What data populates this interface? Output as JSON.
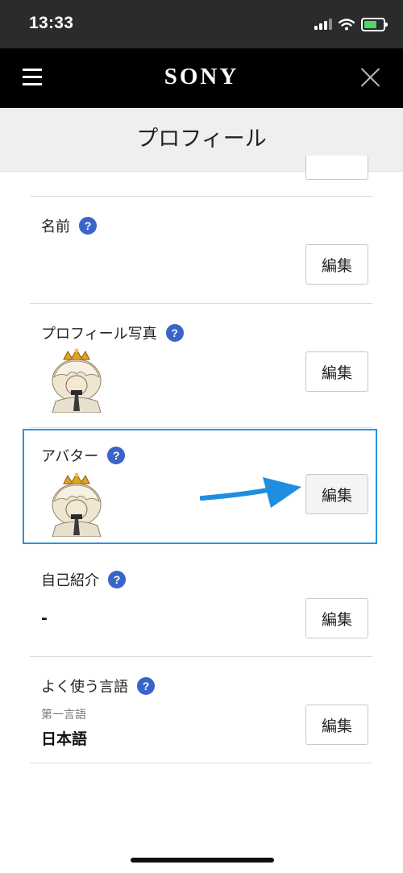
{
  "status_bar": {
    "time": "13:33"
  },
  "nav": {
    "brand": "SONY"
  },
  "page": {
    "title": "プロフィール"
  },
  "sections": {
    "name": {
      "label": "名前",
      "edit": "編集"
    },
    "profile_photo": {
      "label": "プロフィール写真",
      "edit": "編集"
    },
    "avatar": {
      "label": "アバター",
      "edit": "編集"
    },
    "bio": {
      "label": "自己紹介",
      "value": "-",
      "edit": "編集"
    },
    "language": {
      "label": "よく使う言語",
      "sub_label": "第一言語",
      "value": "日本語",
      "edit": "編集"
    }
  },
  "help_glyph": "?",
  "colors": {
    "status_bar_bg": "#2a2b2d",
    "nav_bg": "#000000",
    "title_bg": "#efefef",
    "help_icon": "#3a64c9",
    "highlight": "#2a94dd",
    "arrow": "#1f8ee0",
    "battery": "#4cd964"
  },
  "icons": [
    "menu-icon",
    "close-icon",
    "help-icon",
    "signal-icon",
    "wifi-icon",
    "battery-icon",
    "arrow-icon"
  ]
}
